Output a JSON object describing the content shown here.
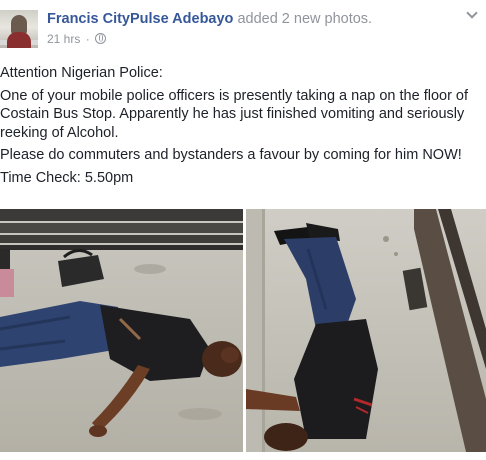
{
  "post": {
    "author": "Francis CityPulse Adebayo",
    "action": " added 2 new photos.",
    "timestamp": "21 hrs",
    "separator": "·",
    "privacy_icon": "globe-icon",
    "options_icon": "chevron-down-icon",
    "paragraphs": [
      "Attention Nigerian Police:",
      "One of your mobile police officers is presently taking a nap on the floor of Costain Bus Stop. Apparently he has just finished vomiting and seriously reeking of Alcohol.",
      "Please do commuters and bystanders a favour by coming for him NOW!",
      "Time Check: 5.50pm"
    ]
  },
  "colors": {
    "author_link": "#365899",
    "meta_gray": "#90949c",
    "body_text": "#1d2129"
  }
}
